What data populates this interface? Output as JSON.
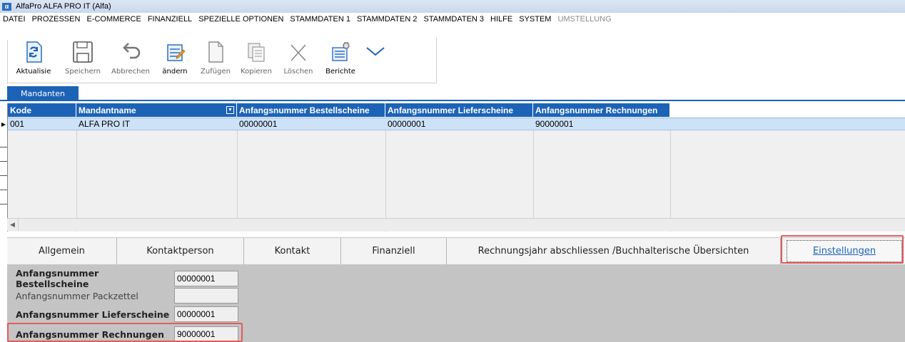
{
  "window": {
    "title": "AlfaPro ALFA PRO IT (Alfa)",
    "logo_text": "α"
  },
  "menu": [
    {
      "label": "DATEI",
      "enabled": true
    },
    {
      "label": "PROZESSEN",
      "enabled": true
    },
    {
      "label": "E-COMMERCE",
      "enabled": true
    },
    {
      "label": "FINANZIELL",
      "enabled": true
    },
    {
      "label": "SPEZIELLE OPTIONEN",
      "enabled": true
    },
    {
      "label": "STAMMDATEN 1",
      "enabled": true
    },
    {
      "label": "STAMMDATEN 2",
      "enabled": true
    },
    {
      "label": "STAMMDATEN 3",
      "enabled": true
    },
    {
      "label": "HILFE",
      "enabled": true
    },
    {
      "label": "SYSTEM",
      "enabled": true
    },
    {
      "label": "UMSTELLUNG",
      "enabled": false
    }
  ],
  "toolbar": {
    "refresh": "Aktualisie",
    "save": "Speichern",
    "cancel": "Abbrechen",
    "edit": "ändern",
    "add": "Zufügen",
    "copy": "Kopieren",
    "delete": "Löschen",
    "reports": "Berichte"
  },
  "tabs": {
    "mandanten": "Mandanten"
  },
  "grid": {
    "headers": [
      "Kode",
      "Mandantname",
      "Anfangsnummer Bestellscheine",
      "Anfangsnummer Lieferscheine",
      "Anfangsnummer Rechnungen"
    ],
    "rows": [
      [
        "001",
        "ALFA PRO IT",
        "00000001",
        "00000001",
        "90000001"
      ]
    ]
  },
  "detail_tabs": [
    "Allgemein",
    "Kontaktperson",
    "Kontakt",
    "Finanziell",
    "Rechnungsjahr abschliessen /Buchhalterische Übersichten",
    "Einstellungen"
  ],
  "form": {
    "fields": [
      {
        "label": "Anfangsnummer Bestellscheine",
        "value": "00000001"
      },
      {
        "label": "Anfangsnummer Packzettel",
        "value": ""
      },
      {
        "label": "Anfangsnummer Lieferscheine",
        "value": "00000001"
      },
      {
        "label": "Anfangsnummer Rechnungen",
        "value": "90000001"
      }
    ]
  },
  "colors": {
    "accent": "#1c63b7",
    "selected_row": "#cde2f7",
    "highlight": "#e25c5c",
    "form_bg": "#c4c4c4"
  }
}
